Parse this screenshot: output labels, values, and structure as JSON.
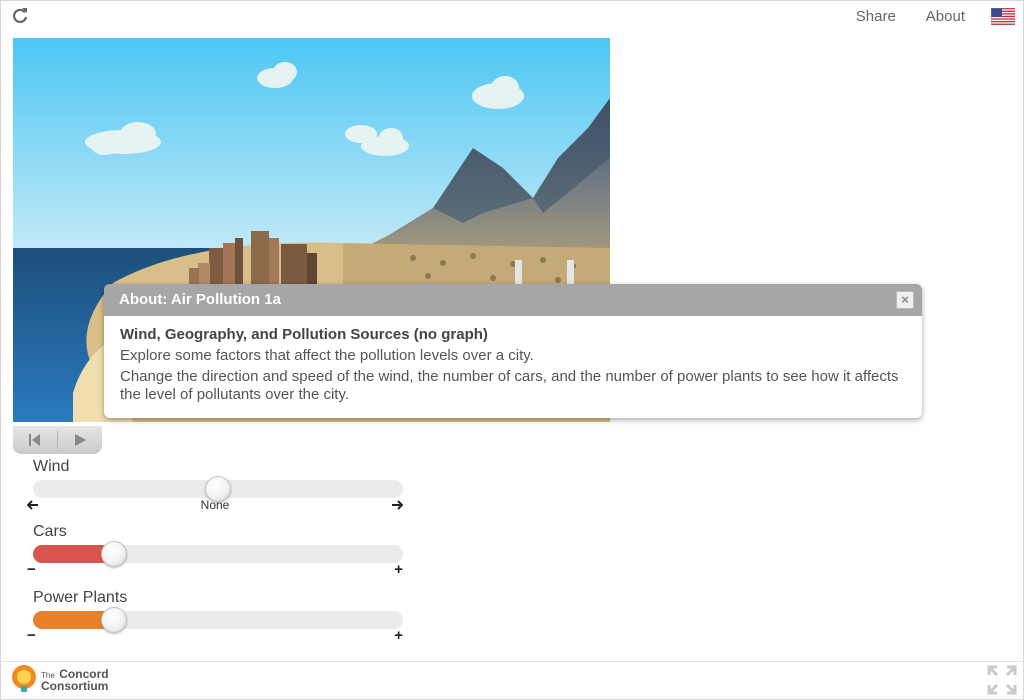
{
  "header": {
    "share_label": "Share",
    "about_label": "About",
    "flag_icon": "us-flag-icon",
    "reload_icon": "reload-icon"
  },
  "playback": {
    "reset_icon": "reset-to-start-icon",
    "play_icon": "play-icon"
  },
  "sliders": {
    "wind": {
      "label": "Wind",
      "center_label": "None",
      "value_fraction": 0.5,
      "left_icon": "arrow-left-icon",
      "right_icon": "arrow-right-icon"
    },
    "cars": {
      "label": "Cars",
      "minus": "−",
      "plus": "+",
      "value_fraction": 0.22,
      "fill_color": "#d9534f"
    },
    "power_plants": {
      "label": "Power Plants",
      "minus": "−",
      "plus": "+",
      "value_fraction": 0.22,
      "fill_color": "#e8822a"
    }
  },
  "dialog": {
    "title": "About: Air Pollution 1a",
    "close_label": "×",
    "heading": "Wind, Geography, and Pollution Sources (no graph)",
    "line1": "Explore some factors that affect the pollution levels over a city.",
    "line2": "Change the direction and speed of the wind, the number of cars, and the number of power plants to see how it affects the level of pollutants over the city."
  },
  "footer": {
    "logo_small": "The",
    "logo_line1": "Concord",
    "logo_line2": "Consortium",
    "fullscreen_icon": "fullscreen-icon"
  }
}
